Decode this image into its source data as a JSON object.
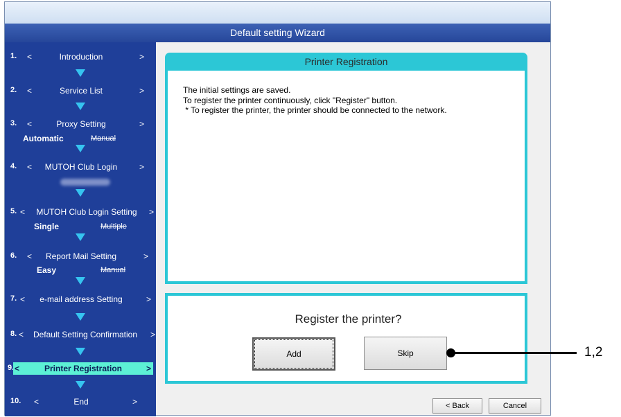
{
  "window": {
    "title": "Default setting Wizard"
  },
  "sidebar": {
    "steps": [
      {
        "num": "1.",
        "label": "Introduction"
      },
      {
        "num": "2.",
        "label": "Service List"
      },
      {
        "num": "3.",
        "label": "Proxy Setting",
        "options": [
          "Automatic",
          "Manual"
        ]
      },
      {
        "num": "4.",
        "label": "MUTOH Club Login"
      },
      {
        "num": "5.",
        "label": "MUTOH Club Login Setting",
        "options": [
          "Single",
          "Multiple"
        ]
      },
      {
        "num": "6.",
        "label": "Report Mail Setting",
        "options": [
          "Easy",
          "Manual"
        ]
      },
      {
        "num": "7.",
        "label": "e-mail address Setting"
      },
      {
        "num": "8.",
        "label": "Default Setting Confirmation"
      },
      {
        "num": "9.",
        "label": "Printer Registration",
        "active": true
      },
      {
        "num": "10.",
        "label": "End"
      }
    ],
    "lt": "<",
    "gt": ">"
  },
  "main": {
    "heading": "Printer Registration",
    "message_lines": [
      "The initial settings are saved.",
      "To register the printer continuously, click \"Register\" button.",
      " * To register the printer, the printer should be connected to the network."
    ],
    "question": "Register the printer?",
    "add_label": "Add",
    "skip_label": "Skip"
  },
  "footer": {
    "back_label": "< Back",
    "cancel_label": "Cancel"
  },
  "callout": {
    "label": "1,2"
  },
  "colors": {
    "sidebar": "#1f3f99",
    "accent": "#2cc7d6",
    "active_step": "#5cf0d5",
    "arrow": "#36c4f0"
  }
}
